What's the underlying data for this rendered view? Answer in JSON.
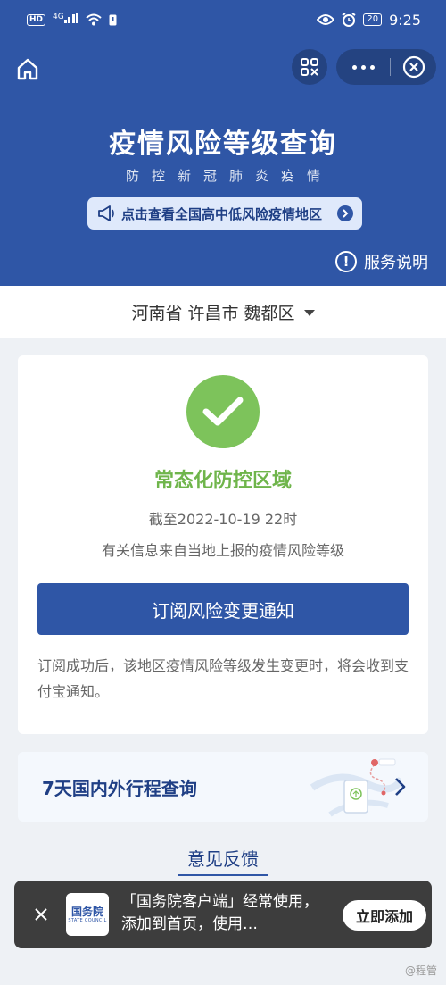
{
  "status_bar": {
    "hd": "HD",
    "network": "4G",
    "battery": "20",
    "time": "9:25"
  },
  "header": {
    "title": "疫情风险等级查询",
    "subtitle": "防控新冠肺炎疫情",
    "banner_text": "点击查看全国高中低风险疫情地区",
    "service_label": "服务说明",
    "service_symbol": "!"
  },
  "region": {
    "label": "河南省 许昌市 魏都区"
  },
  "status_card": {
    "risk_level": "常态化防控区域",
    "as_of": "截至2022-10-19 22时",
    "source": "有关信息来自当地上报的疫情风险等级",
    "subscribe_button": "订阅风险变更通知",
    "note": "订阅成功后，该地区疫情风险等级发生变更时，将会收到支付宝通知。"
  },
  "itinerary": {
    "label": "7天国内外行程查询"
  },
  "feedback": {
    "label": "意见反馈"
  },
  "toast": {
    "logo_main": "国务院",
    "logo_sub": "STATE COUNCIL",
    "message": "「国务院客户端」经常使用，添加到首页，使用…",
    "add_button": "立即添加"
  },
  "watermark": "@程管",
  "colors": {
    "primary": "#2f56a6",
    "success": "#7dc35b",
    "background": "#eef1f5"
  }
}
